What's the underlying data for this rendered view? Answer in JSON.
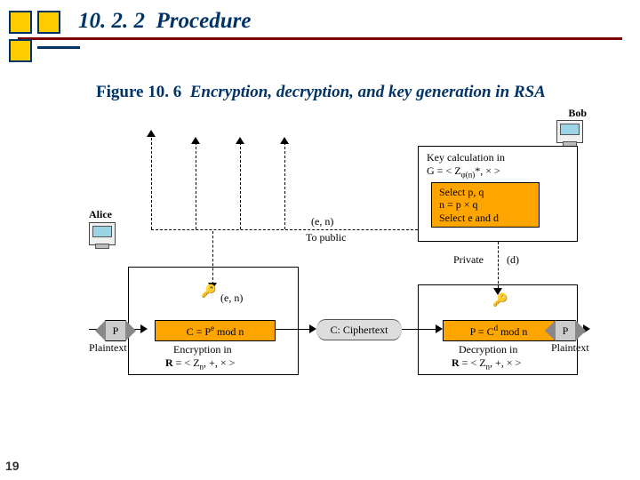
{
  "header": {
    "section_number": "10. 2. 2",
    "section_title": "Procedure"
  },
  "figure": {
    "ref": "Figure 10. 6",
    "caption": "Encryption, decryption, and key generation in RSA"
  },
  "actors": {
    "alice": "Alice",
    "bob": "Bob"
  },
  "bob_box": {
    "key_calc_line": "Key calculation in",
    "key_calc_g": "G = < Zφ(n)*, × >",
    "select_pq": "Select p, q",
    "n_formula": "n = p × q",
    "select_ed": "Select e and d",
    "private_label": "Private",
    "private_d": "(d)"
  },
  "public": {
    "en": "(e, n)",
    "to_public": "To public"
  },
  "alice_side": {
    "plaintext": "Plaintext",
    "P": "P",
    "en_pair": "(e, n)",
    "enc_formula": "C = Pe mod n",
    "encryption_in": "Encryption in",
    "ring_r": "R = < Zn, +, × >"
  },
  "ciphertext": {
    "label": "C: Ciphertext"
  },
  "bob_decrypt": {
    "dec_formula": "P = Cd mod n",
    "decryption_in": "Decryption in",
    "ring_r": "R = < Zn, +, × >",
    "plaintext": "Plaintext",
    "P": "P"
  },
  "slide_number": "19"
}
